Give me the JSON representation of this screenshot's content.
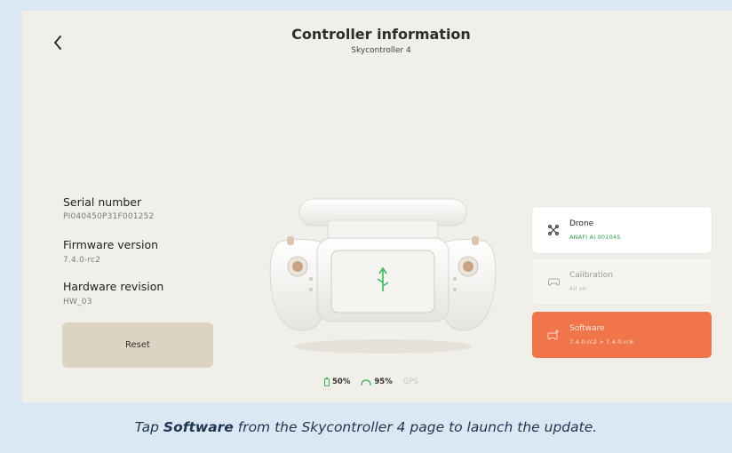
{
  "header": {
    "title": "Controller information",
    "subtitle": "Skycontroller 4"
  },
  "info": {
    "serial_label": "Serial number",
    "serial_value": "PI040450P31F001252",
    "firmware_label": "Firmware version",
    "firmware_value": "7.4.0-rc2",
    "hardware_label": "Hardware revision",
    "hardware_value": "HW_03"
  },
  "reset_label": "Reset",
  "status": {
    "controller_battery": "50%",
    "drone_battery": "95%",
    "gps_label": "GPS"
  },
  "cards": {
    "drone": {
      "title": "Drone",
      "subtitle": "ANAFI Ai 001045"
    },
    "calibration": {
      "title": "Calibration",
      "subtitle": "All ok"
    },
    "software": {
      "title": "Software",
      "subtitle": "7.4.0-rc2 > 7.4.0-rc6"
    }
  },
  "caption": {
    "prefix": "Tap ",
    "bold": "Software",
    "suffix": " from the Skycontroller 4 page to launch the update."
  },
  "colors": {
    "accent": "#f0754b",
    "screen_bg": "#f1efe9",
    "success": "#2ea24a"
  },
  "icons": {
    "back": "chevron-left-icon",
    "drone": "drone-icon",
    "calibration": "controller-calibration-icon",
    "software": "software-update-icon",
    "battery": "battery-icon",
    "drone_battery": "drone-battery-icon",
    "usb": "usb-icon"
  }
}
